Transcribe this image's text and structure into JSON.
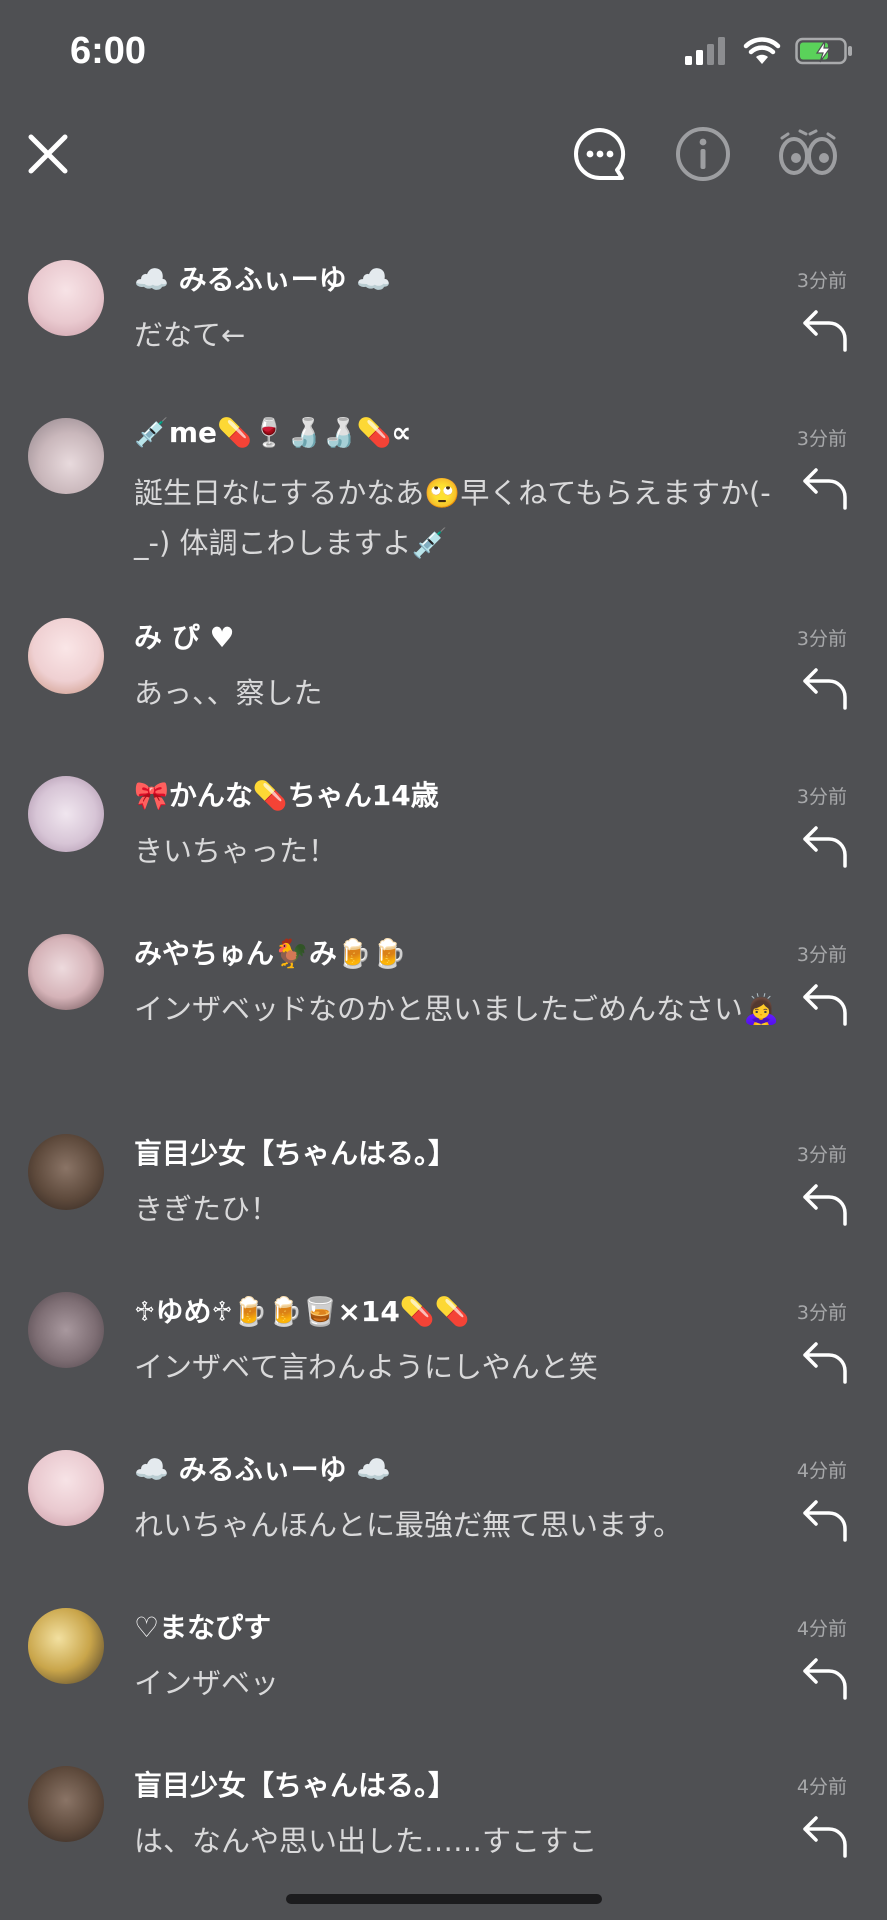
{
  "status": {
    "time": "6:00"
  },
  "colors": {
    "background": "#4f5053",
    "battery": "#5ad25a"
  },
  "comments": [
    {
      "name": "☁️ みるふぃーゆ ☁️",
      "message": "だなて←",
      "time": "3分前",
      "avatar": "#e9c9cf"
    },
    {
      "name": "💉me💊🍷🍶🍶💊∝",
      "message": "誕生日なにするかなあ🙄早くねてもらえますか(-_-) 体調こわしますよ💉",
      "time": "3分前",
      "avatar": "#c9b7bb"
    },
    {
      "name": "み ぴ ♥",
      "message": "あっ、、察した",
      "time": "3分前",
      "avatar": "#efd0d2"
    },
    {
      "name": "🎀かんな💊ちゃん14歳",
      "message": "きいちゃった！",
      "time": "3分前",
      "avatar": "#d7c5d6"
    },
    {
      "name": "みやちゅん🐓み🍺🍺",
      "message": "インザベッドなのかと思いましたごめんなさい🙇‍♀️",
      "time": "3分前",
      "avatar": "#d5b3b8"
    },
    {
      "name": "盲目少女【ちゃんはる。】",
      "message": "きぎたひ！",
      "time": "3分前",
      "avatar": "#5e4a3c"
    },
    {
      "name": "♱ゆめ♱🍺🍺🥃×14💊💊",
      "message": "インザベて言わんようにしやんと笑",
      "time": "3分前",
      "avatar": "#7e6e74"
    },
    {
      "name": "☁️ みるふぃーゆ ☁️",
      "message": "れいちゃんほんとに最強だ無て思います。",
      "time": "4分前",
      "avatar": "#e9c9cf"
    },
    {
      "name": "♡まなぴす",
      "message": "インザベッ",
      "time": "4分前",
      "avatar": "#c9a54a"
    },
    {
      "name": "盲目少女【ちゃんはる。】",
      "message": "は、なんや思い出した……すこすこ",
      "time": "4分前",
      "avatar": "#5e4a3c"
    }
  ]
}
